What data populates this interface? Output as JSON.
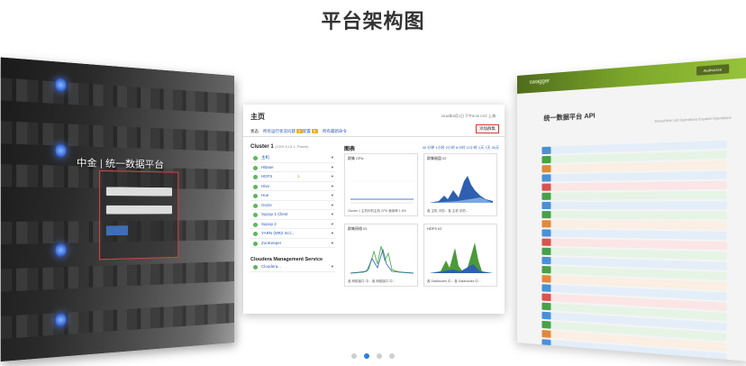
{
  "page": {
    "title": "平台架构图"
  },
  "slides": {
    "left": {
      "login_title": "中金 | 统一数据平台"
    },
    "center": {
      "heading": "主页",
      "timestamp": "2018年8月1日 下午5:05 CST 上海",
      "nav": [
        {
          "label": "状态",
          "badge": ""
        },
        {
          "label": "所有运行状况问题",
          "badge": "2"
        },
        {
          "label": "配置",
          "badge": "5"
        },
        {
          "label": "所有最新命令",
          "badge": ""
        }
      ],
      "add_cluster_button": "添加群集",
      "cluster": {
        "title": "Cluster 1",
        "subtitle": "(CDH 5.13.1, Parcel)",
        "services": [
          {
            "name": "主机",
            "status": "green",
            "warn": ""
          },
          {
            "name": "HBase",
            "status": "green",
            "warn": ""
          },
          {
            "name": "HDFS",
            "status": "green",
            "warn": "1"
          },
          {
            "name": "Hive",
            "status": "green",
            "warn": ""
          },
          {
            "name": "Hue",
            "status": "green",
            "warn": ""
          },
          {
            "name": "Oozie",
            "status": "green",
            "warn": ""
          },
          {
            "name": "Sqoop 1 Client",
            "status": "green",
            "warn": ""
          },
          {
            "name": "Sqoop 2",
            "status": "green",
            "warn": ""
          },
          {
            "name": "YARN (MR2 Incl...",
            "status": "green",
            "warn": ""
          },
          {
            "name": "ZooKeeper",
            "status": "green",
            "warn": ""
          }
        ]
      },
      "cms": {
        "title": "Cloudera Management Service",
        "item": "Cloudera..."
      },
      "charts_title": "图表",
      "charts_range": "30 分钟 1小时 2小时 6小时 12小时 1天 7天 30天",
      "charts": [
        {
          "label": "群集 CPU",
          "legend": "Cluster 1 主机中的主机 CPU 使用率 1.6%"
        },
        {
          "label": "群集磁盘 IO",
          "legend": "各 主机 中的... 各 主机 中的..."
        },
        {
          "label": "群集网络 IO",
          "legend": "各 网络接口 中... 各 网络接口 中..."
        },
        {
          "label": "HDFS IO",
          "legend": "各 DataNodes 中... 各 DataNodes 中..."
        }
      ]
    },
    "right": {
      "logo": "swagger",
      "top_button": "Authorize",
      "title": "统一数据平台 API",
      "links": "Show/Hide   List Operations   Expand Operations",
      "row_count": 22
    }
  },
  "pagination": {
    "count": 4,
    "active_index": 1
  },
  "colors": {
    "accent": "#2a7de1",
    "swagger_green": "#7ba62a",
    "status_green": "#5cb85c",
    "status_yellow": "#e6b020"
  }
}
